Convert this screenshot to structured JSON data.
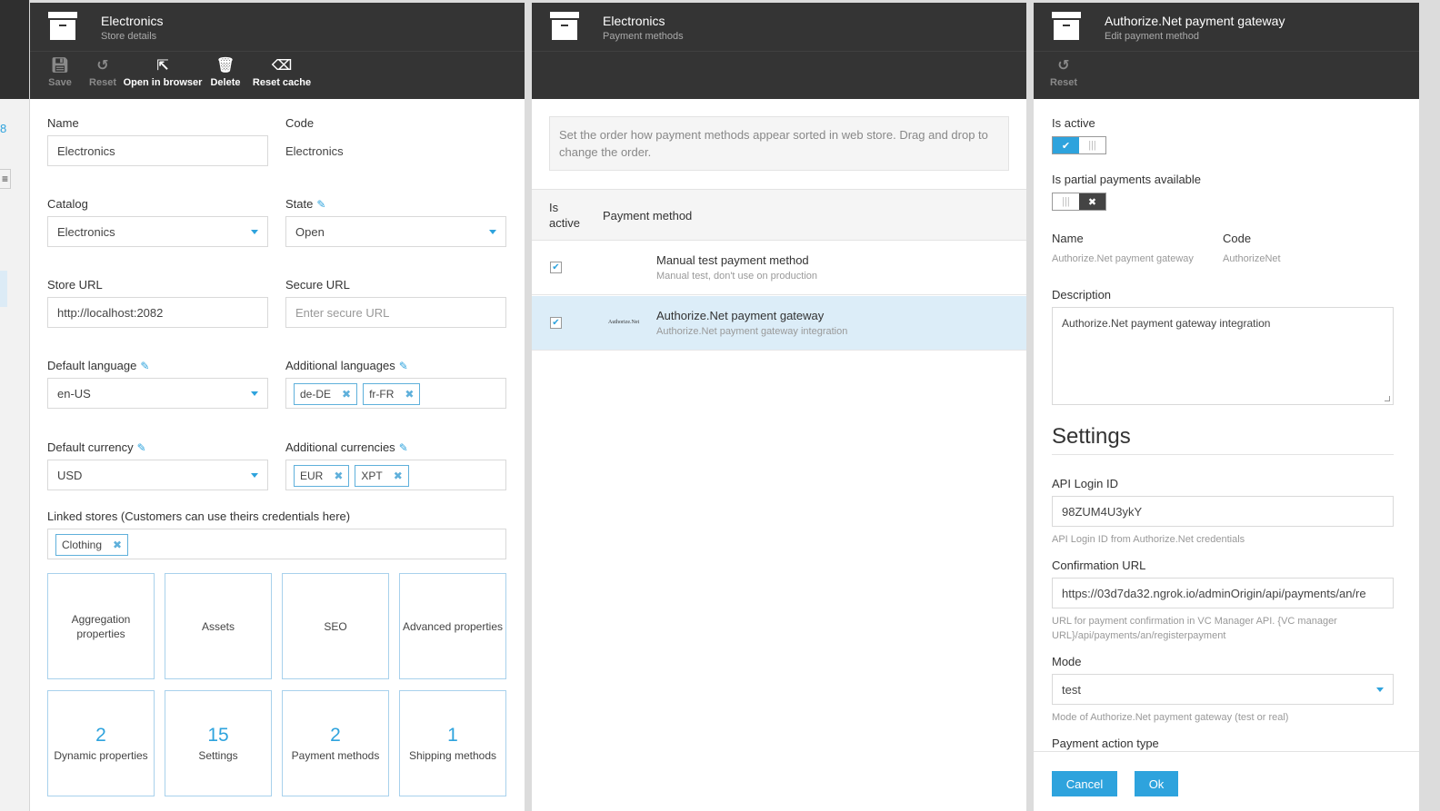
{
  "left_strip": {
    "mark": "8",
    "menu_icon": "menu-icon"
  },
  "blade1": {
    "title": "Electronics",
    "subtitle": "Store details",
    "toolbar": [
      {
        "label": "Save",
        "icon": "save-icon",
        "enabled": false
      },
      {
        "label": "Reset",
        "icon": "undo-icon",
        "enabled": false
      },
      {
        "label": "Open in browser",
        "icon": "external-link-icon",
        "enabled": true
      },
      {
        "label": "Delete",
        "icon": "trash-icon",
        "enabled": true
      },
      {
        "label": "Reset cache",
        "icon": "eraser-icon",
        "enabled": true
      }
    ],
    "name_label": "Name",
    "name_value": "Electronics",
    "code_label": "Code",
    "code_value": "Electronics",
    "catalog_label": "Catalog",
    "catalog_value": "Electronics",
    "state_label": "State",
    "state_value": "Open",
    "store_url_label": "Store URL",
    "store_url_value": "http://localhost:2082",
    "secure_url_label": "Secure URL",
    "secure_url_placeholder": "Enter secure URL",
    "default_language_label": "Default language",
    "default_language_value": "en-US",
    "additional_languages_label": "Additional languages",
    "additional_languages": [
      "de-DE",
      "fr-FR"
    ],
    "default_currency_label": "Default currency",
    "default_currency_value": "USD",
    "additional_currencies_label": "Additional currencies",
    "additional_currencies": [
      "EUR",
      "XPT"
    ],
    "linked_stores_label": "Linked stores (Customers can use theirs credentials here)",
    "linked_stores": [
      "Clothing"
    ],
    "tiles_row1": [
      {
        "label": "Aggregation properties"
      },
      {
        "label": "Assets"
      },
      {
        "label": "SEO"
      },
      {
        "label": "Advanced properties"
      }
    ],
    "tiles_row2": [
      {
        "count": "2",
        "label": "Dynamic properties"
      },
      {
        "count": "15",
        "label": "Settings"
      },
      {
        "count": "2",
        "label": "Payment methods"
      },
      {
        "count": "1",
        "label": "Shipping methods"
      }
    ]
  },
  "blade2": {
    "title": "Electronics",
    "subtitle": "Payment methods",
    "info": "Set the order how payment methods appear sorted in web store. Drag and drop to change the order.",
    "col_active": "Is active",
    "col_method": "Payment method",
    "rows": [
      {
        "name": "Manual test payment method",
        "description": "Manual test, don't use on production",
        "logo": "",
        "active": true
      },
      {
        "name": "Authorize.Net payment gateway",
        "description": "Authorize.Net payment gateway integration",
        "logo": "Authorize.Net",
        "active": true
      }
    ]
  },
  "blade3": {
    "title": "Authorize.Net payment gateway",
    "subtitle": "Edit payment method",
    "toolbar": [
      {
        "label": "Reset",
        "icon": "undo-icon",
        "enabled": false
      }
    ],
    "is_active_label": "Is active",
    "is_active": true,
    "partial_label": "Is partial payments available",
    "partial": false,
    "name_label": "Name",
    "name_value": "Authorize.Net payment gateway",
    "code_label": "Code",
    "code_value": "AuthorizeNet",
    "description_label": "Description",
    "description_value": "Authorize.Net payment gateway integration",
    "settings_heading": "Settings",
    "api_login_label": "API Login ID",
    "api_login_value": "98ZUM4U3ykY",
    "api_login_hint": "API Login ID from Authorize.Net credentials",
    "confirm_url_label": "Confirmation URL",
    "confirm_url_value": "https://03d7da32.ngrok.io/adminOrigin/api/payments/an/re",
    "confirm_url_hint": "URL for payment confirmation in VC Manager API. {VC manager URL}/api/payments/an/registerpayment",
    "mode_label": "Mode",
    "mode_value": "test",
    "mode_hint": "Mode of Authorize.Net payment gateway (test or real)",
    "payment_action_label": "Payment action type",
    "cancel_label": "Cancel",
    "ok_label": "Ok"
  },
  "colors": {
    "accent": "#2ea3dd",
    "header_bg": "#343434",
    "selected_row": "#dcedf8"
  }
}
